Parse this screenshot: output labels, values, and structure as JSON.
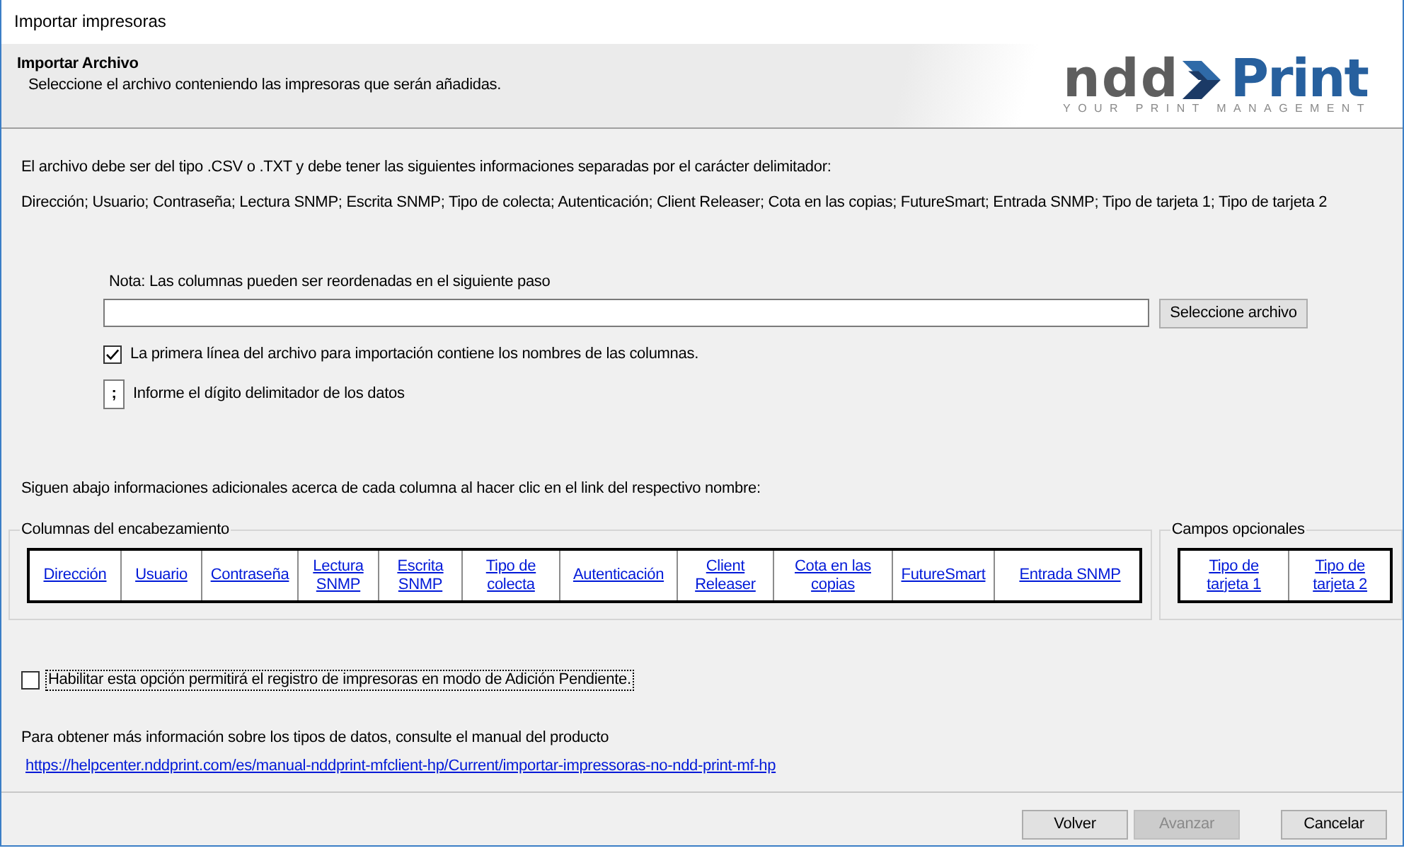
{
  "window": {
    "title": "Importar impresoras"
  },
  "header": {
    "title": "Importar Archivo",
    "subtitle": "Seleccione el archivo conteniendo las impresoras que serán añadidas.",
    "logo": {
      "brand": "ndd",
      "product": "Print",
      "tagline": "YOUR PRINT MANAGEMENT"
    }
  },
  "instructions": [
    "El archivo debe ser del tipo .CSV o .TXT y debe tener las siguientes informaciones separadas por el carácter delimitador:",
    "Dirección; Usuario; Contraseña; Lectura SNMP; Escrita SNMP; Tipo de colecta; Autenticación; Client Releaser; Cota en las copias; FutureSmart; Entrada SNMP; Tipo de tarjeta 1; Tipo de tarjeta 2"
  ],
  "file": {
    "note": "Nota: Las columnas pueden ser reordenadas en el siguiente paso",
    "button": "Seleccione archivo"
  },
  "first_line_option": {
    "label": "La primera línea del archivo para importación contiene los nombres de las columnas.",
    "checked": true
  },
  "delimiter": {
    "value": ";",
    "label": "Informe el dígito delimitador de los datos"
  },
  "columns_intro": "Siguen abajo informaciones adicionales acerca de cada columna al hacer clic en el link del respectivo nombre:",
  "column_groups": [
    {
      "title": "Columnas del encabezamiento",
      "links": [
        "Dirección",
        "Usuario",
        "Contraseña",
        "Lectura SNMP",
        "Escrita SNMP",
        "Tipo de colecta",
        "Autenticación",
        "Client Releaser",
        "Cota en las copias",
        "FutureSmart",
        "Entrada SNMP"
      ]
    },
    {
      "title": "Campos opcionales",
      "links": [
        "Tipo de tarjeta 1",
        "Tipo de tarjeta 2"
      ]
    }
  ],
  "pending_option": {
    "label": "Habilitar esta opción permitirá el registro de impresoras en modo de Adición Pendiente.",
    "checked": false,
    "focused": true
  },
  "help": {
    "text": "Para obtener más información sobre los tipos de datos, consulte el manual del producto",
    "link": "https://helpcenter.nddprint.com/es/manual-nddprint-mfclient-hp/Current/importar-impressoras-no-ndd-print-mf-hp"
  },
  "buttons": [
    {
      "label": "Volver",
      "disabled": false
    },
    {
      "label": "Avanzar",
      "disabled": true
    },
    {
      "label": "Cancelar",
      "disabled": false
    }
  ]
}
